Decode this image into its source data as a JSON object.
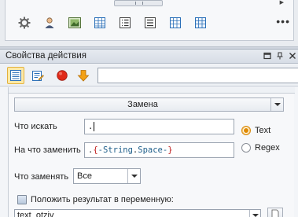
{
  "toolbar": {
    "icons": [
      "gear-icon",
      "user-icon",
      "image-icon",
      "table-icon",
      "numbered-list-icon",
      "list-icon",
      "table-grid-icon",
      "table-grid-2-icon"
    ],
    "more_label": "•••"
  },
  "panel": {
    "title": "Свойства действия",
    "title_buttons": [
      "restore-icon",
      "pin-icon",
      "close-icon"
    ]
  },
  "action_bar": {
    "buttons": [
      "properties-icon",
      "edit-icon",
      "record-icon",
      "down-arrow-icon"
    ],
    "input_value": ""
  },
  "form": {
    "operation": "Замена",
    "find_label": "Что искать",
    "find_value": ".",
    "replace_label": "На что заменить",
    "replace_value": {
      "p1": ".",
      "p2": "{",
      "p3": "-String",
      "p4": ".",
      "p5": "Space",
      "p6": "-",
      "p7": "}"
    },
    "mode_options": {
      "text": "Text",
      "regex": "Regex"
    },
    "selected_mode": "Text",
    "what_replace_label": "Что заменять",
    "what_replace_value": "Все",
    "save_result_label": "Положить результат в переменную:",
    "save_result_checked": true,
    "result_variable": "text_otziv"
  },
  "colors": {
    "active_button_bg": "#fde9a8",
    "radio_selected": "#e08a00",
    "token_brace": "#c02020",
    "token_ident": "#1f5f8b"
  }
}
